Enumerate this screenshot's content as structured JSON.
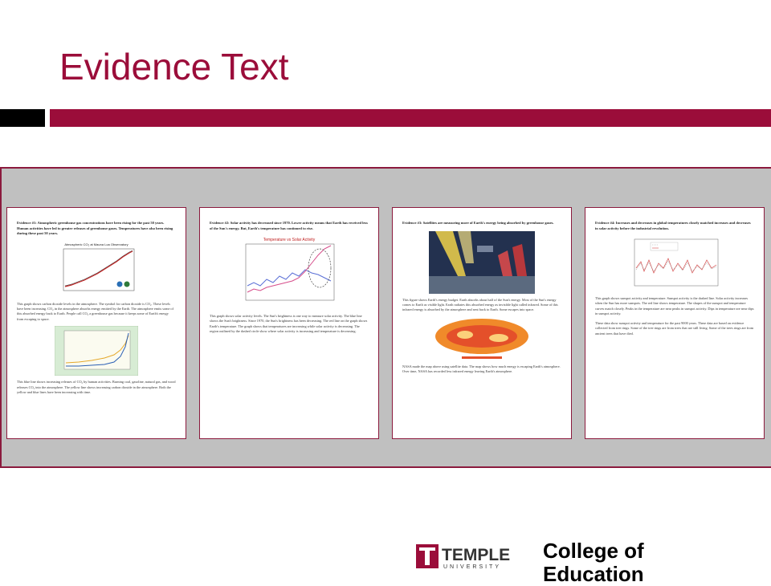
{
  "slide": {
    "title": "Evidence Text"
  },
  "documents": [
    {
      "heading": "Evidence #1: Atmospheric greenhouse gas concentrations have been rising for the past 50 years. Human activities have led to greater releases of greenhouse gases. Temperatures have also been rising during these past 50 years.",
      "figure_title": "Atmospheric CO₂ at Mauna Loa Observatory",
      "paragraph1": "This graph shows carbon dioxide levels in the atmosphere. The symbol for carbon dioxide is CO₂. These levels have been increasing. CO₂ in the atmosphere absorbs energy emitted by the Earth. The atmosphere emits some of this absorbed energy back to Earth. People call CO₂ a greenhouse gas because it keeps some of Earth's energy from escaping to space.",
      "paragraph2": "This blue line shows increasing releases of CO₂ by human activities. Burning coal, gasoline, natural gas, and wood releases CO₂ into the atmosphere. The yellow line shows increasing carbon dioxide in the atmosphere. Both the yellow and blue lines have been increasing with time."
    },
    {
      "heading": "Evidence #2: Solar activity has decreased since 1970. Lower activity means that Earth has received less of the Sun's energy. But, Earth's temperature has continued to rise.",
      "figure_title": "Temperature vs Solar Activity",
      "paragraph1": "This graph shows solar activity levels. The Sun's brightness is one way to measure solar activity. The blue line shows the Sun's brightness. Since 1970, the Sun's brightness has been decreasing. The red line on the graph shows Earth's temperature. The graph shows that temperatures are increasing while solar activity is decreasing. The region outlined by the dashed circle show where solar activity is increasing and temperature is decreasing."
    },
    {
      "heading": "Evidence #3: Satellites are measuring more of Earth's energy being absorbed by greenhouse gases.",
      "paragraph1": "This figure shows Earth's energy budget. Earth absorbs about half of the Sun's energy. Most of the Sun's energy comes to Earth as visible light. Earth radiates this absorbed energy as invisible light called infrared. Some of this infrared energy is absorbed by the atmosphere and sent back to Earth. Some escapes into space.",
      "paragraph2": "NASA made the map above using satellite data. The map shows how much energy is escaping Earth's atmosphere. Over time, NASA has recorded less infrared energy leaving Earth's atmosphere."
    },
    {
      "heading": "Evidence #4: Increases and decreases in global temperatures closely matched increases and decreases in solar activity before the industrial revolution.",
      "paragraph1": "This graph shows sunspot activity and temperature. Sunspot activity is the dashed line. Solar activity increases when the Sun has more sunspots. The red line shows temperature. The shapes of the sunspot and temperature curves match closely. Peaks in the temperature are near peaks in sunspot activity. Dips in temperature are near dips in sunspot activity.",
      "paragraph2": "These data show sunspot activity and temperature for the past 9000 years. These data are based on evidence collected from tree rings. Some of the tree rings are from trees that are still living. Some of the trees rings are from ancient trees that have died."
    }
  ],
  "footer": {
    "logo_text": "TEMPLE",
    "logo_sub": "UNIVERSITY",
    "college_line1": "College of",
    "college_line2": "Education"
  },
  "colors": {
    "brand": "#9b0d3a",
    "panel": "#c0c0c0"
  }
}
